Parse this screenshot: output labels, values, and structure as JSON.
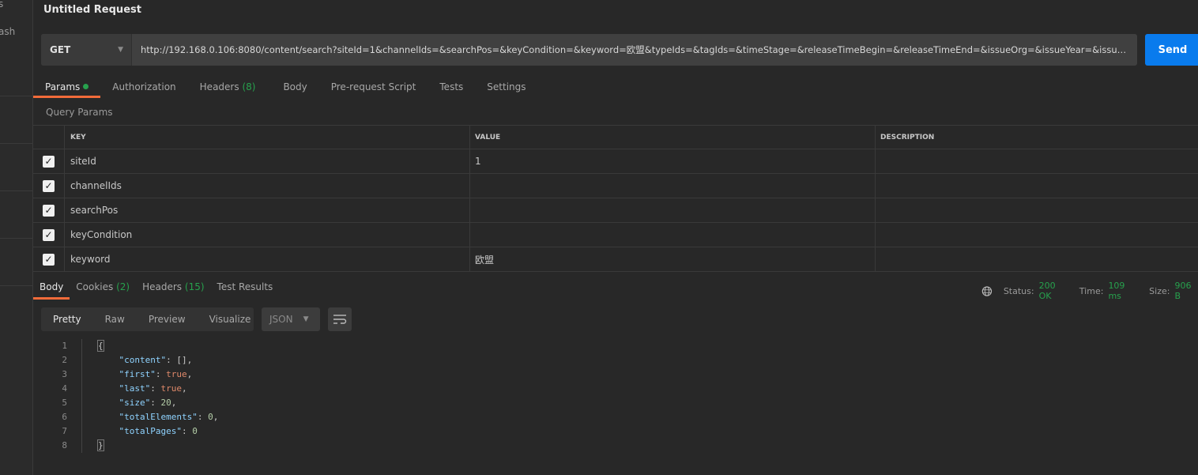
{
  "sidebar": {
    "partial_items": [
      "s",
      "ash"
    ]
  },
  "request": {
    "title": "Untitled Request",
    "method": "GET",
    "url": "http://192.168.0.106:8080/content/search?siteId=1&channelIds=&searchPos=&keyCondition=&keyword=欧盟&typeIds=&tagIds=&timeStage=&releaseTimeBegin=&releaseTimeEnd=&issueOrg=&issueYear=&issueNum=&isTop=",
    "send_label": "Send"
  },
  "request_tabs": [
    {
      "label": "Params"
    },
    {
      "label": "Authorization"
    },
    {
      "label": "Headers",
      "count": "(8)"
    },
    {
      "label": "Body"
    },
    {
      "label": "Pre-request Script"
    },
    {
      "label": "Tests"
    },
    {
      "label": "Settings"
    }
  ],
  "query_params": {
    "label": "Query Params",
    "headers": [
      "KEY",
      "VALUE",
      "DESCRIPTION"
    ],
    "rows": [
      {
        "key": "siteId",
        "value": "1",
        "checked": true
      },
      {
        "key": "channelIds",
        "value": "",
        "checked": true
      },
      {
        "key": "searchPos",
        "value": "",
        "checked": true
      },
      {
        "key": "keyCondition",
        "value": "",
        "checked": true
      },
      {
        "key": "keyword",
        "value": "欧盟",
        "checked": true
      }
    ]
  },
  "response_tabs": [
    {
      "label": "Body"
    },
    {
      "label": "Cookies",
      "count": "(2)"
    },
    {
      "label": "Headers",
      "count": "(15)"
    },
    {
      "label": "Test Results"
    }
  ],
  "status": {
    "status_label": "Status:",
    "status": "200 OK",
    "time_label": "Time:",
    "time": "109 ms",
    "size_label": "Size:",
    "size": "906 B"
  },
  "view_modes": [
    "Pretty",
    "Raw",
    "Preview",
    "Visualize"
  ],
  "format": "JSON",
  "code": {
    "lines": [
      "1",
      "2",
      "3",
      "4",
      "5",
      "6",
      "7",
      "8"
    ],
    "open": "{",
    "close": "}",
    "entries": [
      {
        "key": "\"content\"",
        "value": "[]",
        "type": "p",
        "sep": ","
      },
      {
        "key": "\"first\"",
        "value": "true",
        "type": "b",
        "sep": ","
      },
      {
        "key": "\"last\"",
        "value": "true",
        "type": "b",
        "sep": ","
      },
      {
        "key": "\"size\"",
        "value": "20",
        "type": "n",
        "sep": ","
      },
      {
        "key": "\"totalElements\"",
        "value": "0",
        "type": "n",
        "sep": ","
      },
      {
        "key": "\"totalPages\"",
        "value": "0",
        "type": "n",
        "sep": ""
      }
    ]
  },
  "colors": {
    "accent": "#f26b3a",
    "send": "#097bed",
    "success": "#27a14d"
  }
}
